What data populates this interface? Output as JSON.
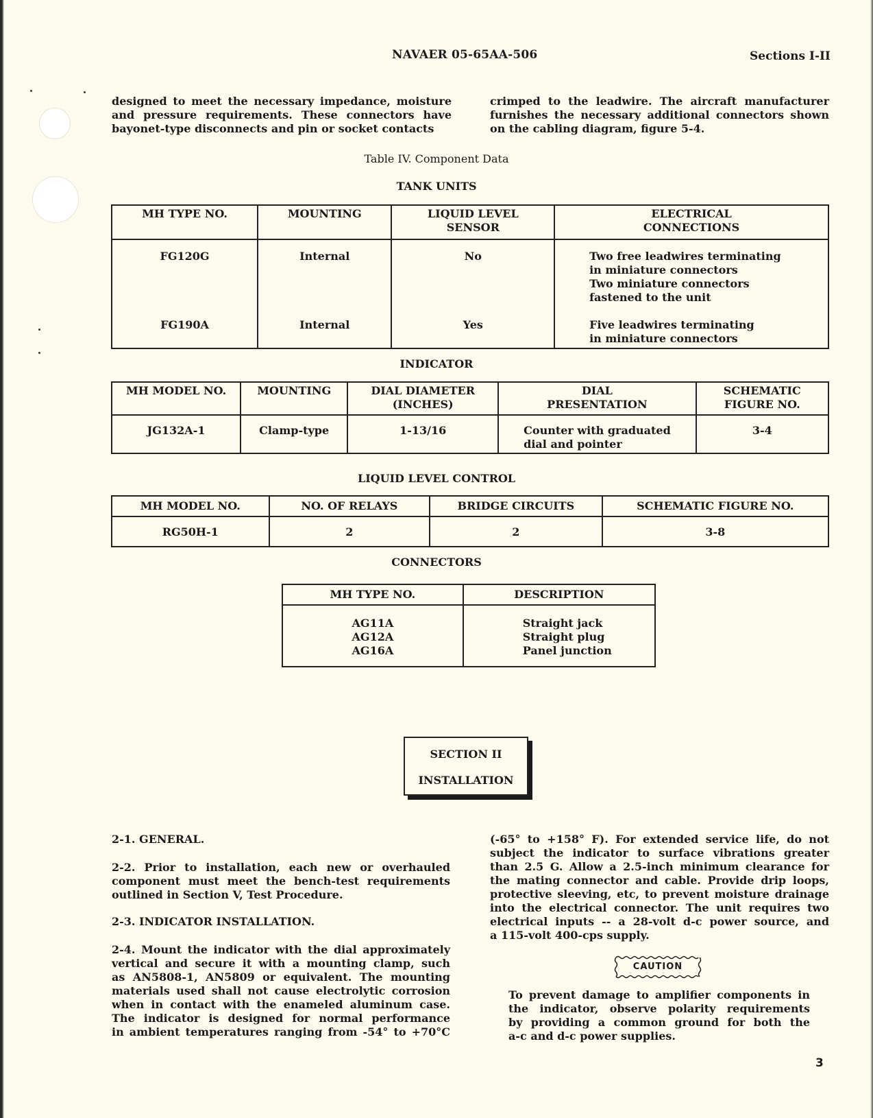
{
  "header": {
    "document_number": "NAVAER 05-65AA-506",
    "sections": "Sections I-II"
  },
  "intro": {
    "left_lines": [
      "designed to meet the necessary impedance, moisture",
      "and pressure requirements. These connectors have",
      "bayonet-type disconnects and pin or socket contacts"
    ],
    "right_lines": [
      "crimped to the leadwire. The aircraft manufacturer",
      "furnishes the necessary additional connectors shown",
      "on the cabling diagram, figure 5-4."
    ]
  },
  "table_title": "Table IV.  Component Data",
  "tank_units": {
    "heading": "TANK UNITS",
    "columns": [
      "MH TYPE NO.",
      "MOUNTING",
      "LIQUID LEVEL SENSOR",
      "ELECTRICAL CONNECTIONS"
    ],
    "rows": [
      {
        "type_no": "FG120G",
        "mounting": "Internal",
        "sensor": "No",
        "connections": [
          "Two free leadwires terminating",
          "in miniature connectors",
          "Two miniature connectors",
          "fastened to the unit"
        ]
      },
      {
        "type_no": "FG190A",
        "mounting": "Internal",
        "sensor": "Yes",
        "connections": [
          "Five leadwires terminating",
          "in miniature connectors"
        ]
      }
    ]
  },
  "indicator": {
    "heading": "INDICATOR",
    "columns": [
      "MH MODEL NO.",
      "MOUNTING",
      "DIAL DIAMETER (INCHES)",
      "DIAL PRESENTATION",
      "SCHEMATIC FIGURE NO."
    ],
    "rows": [
      {
        "model_no": "JG132A-1",
        "mounting": "Clamp-type",
        "dial_diameter": "1-13/16",
        "dial_presentation": [
          "Counter with graduated",
          "dial and pointer"
        ],
        "schematic_figure": "3-4"
      }
    ]
  },
  "liquid_level_control": {
    "heading": "LIQUID LEVEL CONTROL",
    "columns": [
      "MH MODEL NO.",
      "NO.  OF RELAYS",
      "BRIDGE CIRCUITS",
      "SCHEMATIC FIGURE NO."
    ],
    "rows": [
      {
        "model_no": "RG50H-1",
        "relays": "2",
        "bridge_circuits": "2",
        "schematic_figure": "3-8"
      }
    ]
  },
  "connectors": {
    "heading": "CONNECTORS",
    "columns": [
      "MH TYPE NO.",
      "DESCRIPTION"
    ],
    "rows": [
      {
        "type_no": "AG11A",
        "description": "Straight jack"
      },
      {
        "type_no": "AG12A",
        "description": "Straight plug"
      },
      {
        "type_no": "AG16A",
        "description": "Panel junction"
      }
    ]
  },
  "section": {
    "number": "SECTION II",
    "title": "INSTALLATION"
  },
  "body": {
    "p2_1": "2-1. GENERAL.",
    "p2_2_lines": [
      "2-2. Prior to installation, each new or overhauled",
      "component must meet the bench-test requirements",
      "outlined in Section V, Test Procedure."
    ],
    "p2_3": "2-3. INDICATOR INSTALLATION.",
    "p2_4_lines": [
      "2-4. Mount the indicator with the dial approximately",
      "vertical and secure it with a mounting clamp, such",
      "as AN5808-1, AN5809 or equivalent. The mounting",
      "materials used shall not cause electrolytic corrosion",
      "when in contact with the enameled aluminum case.",
      "The indicator is designed for normal performance",
      "in ambient temperatures ranging from -54° to +70°C"
    ],
    "right_lines": [
      "(-65° to +158° F). For extended service life, do not",
      "subject the indicator to surface vibrations greater",
      "than 2.5 G. Allow a 2.5-inch minimum clearance for",
      "the mating connector and cable. Provide drip loops,",
      "protective sleeving, etc, to prevent moisture drainage",
      "into the electrical connector. The unit requires two",
      "electrical inputs -- a 28-volt d-c power source, and",
      "a 115-volt 400-cps supply."
    ],
    "caution_label": "CAUTION",
    "caution_lines": [
      "To prevent damage to amplifier components in",
      "the indicator, observe polarity requirements",
      "by providing a common ground for both the",
      "a-c and d-c power supplies."
    ]
  },
  "page_number": "3"
}
